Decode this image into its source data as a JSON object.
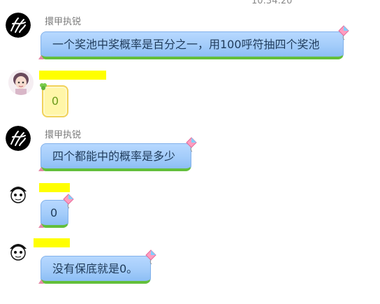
{
  "timestamp": "10:34:20",
  "messages": [
    {
      "sender": "擐甲执锐",
      "text": "一个奖池中奖概率是百分之一，用100呼符抽四个奖池"
    },
    {
      "sender": "",
      "text": "0"
    },
    {
      "sender": "擐甲执锐",
      "text": "四个都能中的概率是多少"
    },
    {
      "sender": "",
      "text": "0"
    },
    {
      "sender": "",
      "text": "没有保底就是0。"
    }
  ],
  "colors": {
    "bubble_blue": "#a3ccfa",
    "bubble_green_edge": "#63bf3a",
    "name_redaction": "#ffff00",
    "dice_bubble": "#fff6a8"
  },
  "icons": [
    "calligraphy-avatar-icon",
    "girl-avatar-icon",
    "ghost-avatar-icon",
    "kite-icon",
    "clover-icon"
  ]
}
